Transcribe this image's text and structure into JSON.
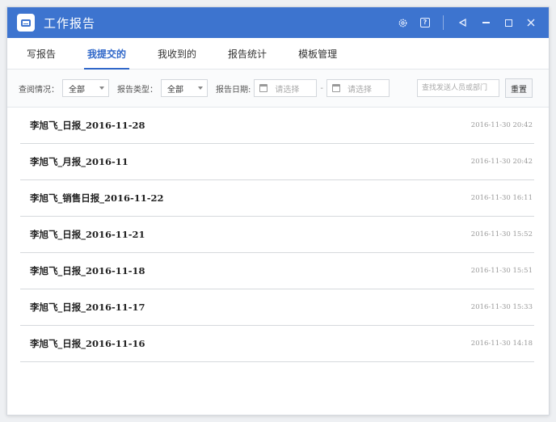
{
  "window": {
    "title": "工作报告"
  },
  "title_actions": {
    "icons": [
      "gear-icon",
      "help-icon",
      "pin-icon",
      "minimize-icon",
      "maximize-icon",
      "close-icon"
    ]
  },
  "tabs": [
    {
      "label": "写报告",
      "active": false
    },
    {
      "label": "我提交的",
      "active": true
    },
    {
      "label": "我收到的",
      "active": false
    },
    {
      "label": "报告统计",
      "active": false
    },
    {
      "label": "模板管理",
      "active": false
    }
  ],
  "filters": {
    "view_label": "查阅情况：",
    "view_value": "全部",
    "type_label": "报告类型：",
    "type_value": "全部",
    "date_label": "报告日期:",
    "date_from_placeholder": "请选择",
    "date_to_placeholder": "请选择",
    "date_separator": "-",
    "search_placeholder": "查找发送人员或部门",
    "reset_label": "重置"
  },
  "reports": [
    {
      "name": "李旭飞_日报_2016-11-28",
      "time": "2016-11-30 20:42"
    },
    {
      "name": "李旭飞_月报_2016-11",
      "time": "2016-11-30 20:42"
    },
    {
      "name": "李旭飞_销售日报_2016-11-22",
      "time": "2016-11-30 16:11"
    },
    {
      "name": "李旭飞_日报_2016-11-21",
      "time": "2016-11-30 15:52"
    },
    {
      "name": "李旭飞_日报_2016-11-18",
      "time": "2016-11-30 15:51"
    },
    {
      "name": "李旭飞_日报_2016-11-17",
      "time": "2016-11-30 15:33"
    },
    {
      "name": "李旭飞_日报_2016-11-16",
      "time": "2016-11-30 14:18"
    }
  ],
  "colors": {
    "accent": "#3d74cf",
    "active_tab": "#2f67c9"
  }
}
